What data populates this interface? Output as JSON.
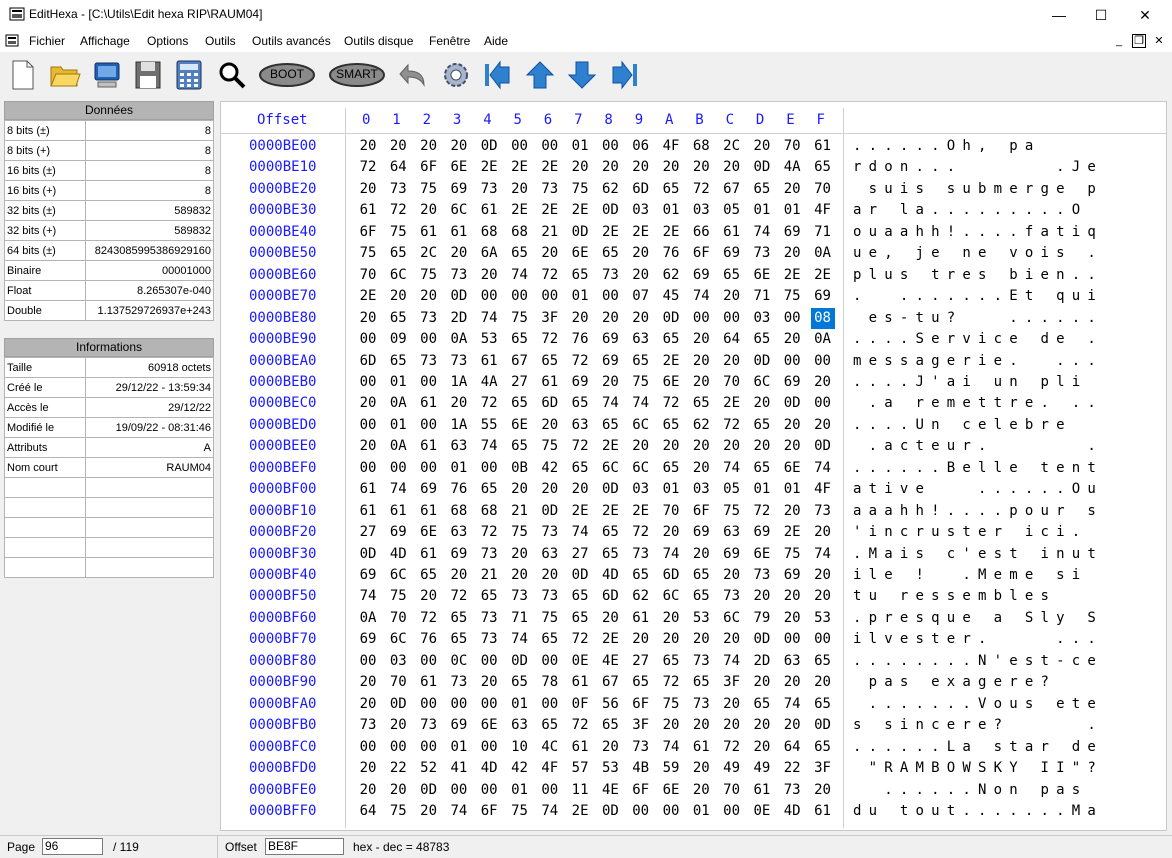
{
  "window": {
    "title": "EditHexa - [C:\\Utils\\Edit hexa RIP\\RAUM04]",
    "min": "—",
    "max": "☐",
    "close": "✕"
  },
  "menu": [
    "Fichier",
    "Affichage",
    "Options",
    "Outils",
    "Outils avancés",
    "Outils disque",
    "Fenêtre",
    "Aide"
  ],
  "mdi": {
    "min": "_",
    "restore": "❐",
    "close": "✕"
  },
  "toolbar": {
    "icons": [
      "new-file",
      "open-folder",
      "computer",
      "save",
      "calculator",
      "search",
      "boot",
      "smart",
      "undo",
      "settings",
      "first",
      "up",
      "down",
      "last"
    ],
    "boot_label": "BOOT",
    "smart_label": "SMART"
  },
  "donnees": {
    "header": "Données",
    "rows": [
      {
        "label": "8 bits (±)",
        "value": "8"
      },
      {
        "label": "8 bits (+)",
        "value": "8"
      },
      {
        "label": "16 bits (±)",
        "value": "8"
      },
      {
        "label": "16 bits (+)",
        "value": "8"
      },
      {
        "label": "32 bits (±)",
        "value": "589832"
      },
      {
        "label": "32 bits (+)",
        "value": "589832"
      },
      {
        "label": "64 bits (±)",
        "value": "8243085995386929160"
      },
      {
        "label": "Binaire",
        "value": "00001000"
      },
      {
        "label": "Float",
        "value": "8.265307e-040"
      },
      {
        "label": "Double",
        "value": "1.137529726937e+243"
      }
    ]
  },
  "informations": {
    "header": "Informations",
    "rows": [
      {
        "label": "Taille",
        "value": "60918 octets"
      },
      {
        "label": "Créé le",
        "value": "29/12/22 - 13:59:34"
      },
      {
        "label": "Accès le",
        "value": "29/12/22"
      },
      {
        "label": "Modifié le",
        "value": "19/09/22 - 08:31:46"
      },
      {
        "label": "Attributs",
        "value": "A"
      },
      {
        "label": "Nom court",
        "value": "RAUM04"
      },
      {
        "label": "",
        "value": ""
      },
      {
        "label": "",
        "value": ""
      },
      {
        "label": "",
        "value": ""
      },
      {
        "label": "",
        "value": ""
      },
      {
        "label": "",
        "value": ""
      }
    ]
  },
  "hex": {
    "offset_header": "Offset",
    "columns": [
      "0",
      "1",
      "2",
      "3",
      "4",
      "5",
      "6",
      "7",
      "8",
      "9",
      "A",
      "B",
      "C",
      "D",
      "E",
      "F"
    ],
    "selected": {
      "row": 8,
      "col": 15
    },
    "rows": [
      {
        "offset": "0000BE00",
        "bytes": [
          "20",
          "20",
          "20",
          "20",
          "0D",
          "00",
          "00",
          "01",
          "00",
          "06",
          "4F",
          "68",
          "2C",
          "20",
          "70",
          "61"
        ],
        "ascii": "......Oh, pa"
      },
      {
        "offset": "0000BE10",
        "bytes": [
          "72",
          "64",
          "6F",
          "6E",
          "2E",
          "2E",
          "2E",
          "20",
          "20",
          "20",
          "20",
          "20",
          "20",
          "0D",
          "4A",
          "65"
        ],
        "ascii": "rdon...      .Je"
      },
      {
        "offset": "0000BE20",
        "bytes": [
          "20",
          "73",
          "75",
          "69",
          "73",
          "20",
          "73",
          "75",
          "62",
          "6D",
          "65",
          "72",
          "67",
          "65",
          "20",
          "70"
        ],
        "ascii": " suis submerge p"
      },
      {
        "offset": "0000BE30",
        "bytes": [
          "61",
          "72",
          "20",
          "6C",
          "61",
          "2E",
          "2E",
          "2E",
          "0D",
          "03",
          "01",
          "03",
          "05",
          "01",
          "01",
          "4F"
        ],
        "ascii": "ar la.........O"
      },
      {
        "offset": "0000BE40",
        "bytes": [
          "6F",
          "75",
          "61",
          "61",
          "68",
          "68",
          "21",
          "0D",
          "2E",
          "2E",
          "2E",
          "66",
          "61",
          "74",
          "69",
          "71"
        ],
        "ascii": "ouaahh!....fatiq"
      },
      {
        "offset": "0000BE50",
        "bytes": [
          "75",
          "65",
          "2C",
          "20",
          "6A",
          "65",
          "20",
          "6E",
          "65",
          "20",
          "76",
          "6F",
          "69",
          "73",
          "20",
          "0A"
        ],
        "ascii": "ue, je ne vois ."
      },
      {
        "offset": "0000BE60",
        "bytes": [
          "70",
          "6C",
          "75",
          "73",
          "20",
          "74",
          "72",
          "65",
          "73",
          "20",
          "62",
          "69",
          "65",
          "6E",
          "2E",
          "2E"
        ],
        "ascii": "plus tres bien.."
      },
      {
        "offset": "0000BE70",
        "bytes": [
          "2E",
          "20",
          "20",
          "0D",
          "00",
          "00",
          "00",
          "01",
          "00",
          "07",
          "45",
          "74",
          "20",
          "71",
          "75",
          "69"
        ],
        "ascii": ".  .......Et qui"
      },
      {
        "offset": "0000BE80",
        "bytes": [
          "20",
          "65",
          "73",
          "2D",
          "74",
          "75",
          "3F",
          "20",
          "20",
          "20",
          "0D",
          "00",
          "00",
          "03",
          "00",
          "08"
        ],
        "ascii": " es-tu?   ......"
      },
      {
        "offset": "0000BE90",
        "bytes": [
          "00",
          "09",
          "00",
          "0A",
          "53",
          "65",
          "72",
          "76",
          "69",
          "63",
          "65",
          "20",
          "64",
          "65",
          "20",
          "0A"
        ],
        "ascii": "....Service de ."
      },
      {
        "offset": "0000BEA0",
        "bytes": [
          "6D",
          "65",
          "73",
          "73",
          "61",
          "67",
          "65",
          "72",
          "69",
          "65",
          "2E",
          "20",
          "20",
          "0D",
          "00",
          "00"
        ],
        "ascii": "messagerie.  ..."
      },
      {
        "offset": "0000BEB0",
        "bytes": [
          "00",
          "01",
          "00",
          "1A",
          "4A",
          "27",
          "61",
          "69",
          "20",
          "75",
          "6E",
          "20",
          "70",
          "6C",
          "69",
          "20"
        ],
        "ascii": "....J'ai un pli "
      },
      {
        "offset": "0000BEC0",
        "bytes": [
          "20",
          "0A",
          "61",
          "20",
          "72",
          "65",
          "6D",
          "65",
          "74",
          "74",
          "72",
          "65",
          "2E",
          "20",
          "0D",
          "00"
        ],
        "ascii": " .a remettre. .."
      },
      {
        "offset": "0000BED0",
        "bytes": [
          "00",
          "01",
          "00",
          "1A",
          "55",
          "6E",
          "20",
          "63",
          "65",
          "6C",
          "65",
          "62",
          "72",
          "65",
          "20",
          "20"
        ],
        "ascii": "....Un celebre  "
      },
      {
        "offset": "0000BEE0",
        "bytes": [
          "20",
          "0A",
          "61",
          "63",
          "74",
          "65",
          "75",
          "72",
          "2E",
          "20",
          "20",
          "20",
          "20",
          "20",
          "20",
          "0D"
        ],
        "ascii": " .acteur.      ."
      },
      {
        "offset": "0000BEF0",
        "bytes": [
          "00",
          "00",
          "00",
          "01",
          "00",
          "0B",
          "42",
          "65",
          "6C",
          "6C",
          "65",
          "20",
          "74",
          "65",
          "6E",
          "74"
        ],
        "ascii": "......Belle tent"
      },
      {
        "offset": "0000BF00",
        "bytes": [
          "61",
          "74",
          "69",
          "76",
          "65",
          "20",
          "20",
          "20",
          "0D",
          "03",
          "01",
          "03",
          "05",
          "01",
          "01",
          "4F",
          "75"
        ],
        "ascii": "ative   ......Ou"
      },
      {
        "offset": "0000BF10",
        "bytes": [
          "61",
          "61",
          "61",
          "68",
          "68",
          "21",
          "0D",
          "2E",
          "2E",
          "2E",
          "70",
          "6F",
          "75",
          "72",
          "20",
          "73"
        ],
        "ascii": "aaahh!....pour s"
      },
      {
        "offset": "0000BF20",
        "bytes": [
          "27",
          "69",
          "6E",
          "63",
          "72",
          "75",
          "73",
          "74",
          "65",
          "72",
          "20",
          "69",
          "63",
          "69",
          "2E",
          "20"
        ],
        "ascii": "'incruster ici. "
      },
      {
        "offset": "0000BF30",
        "bytes": [
          "0D",
          "4D",
          "61",
          "69",
          "73",
          "20",
          "63",
          "27",
          "65",
          "73",
          "74",
          "20",
          "69",
          "6E",
          "75",
          "74"
        ],
        "ascii": ".Mais c'est inut"
      },
      {
        "offset": "0000BF40",
        "bytes": [
          "69",
          "6C",
          "65",
          "20",
          "21",
          "20",
          "20",
          "0D",
          "4D",
          "65",
          "6D",
          "65",
          "20",
          "73",
          "69",
          "20"
        ],
        "ascii": "ile !  .Meme si "
      },
      {
        "offset": "0000BF50",
        "bytes": [
          "74",
          "75",
          "20",
          "72",
          "65",
          "73",
          "73",
          "65",
          "6D",
          "62",
          "6C",
          "65",
          "73",
          "20",
          "20",
          "20"
        ],
        "ascii": "tu ressembles   "
      },
      {
        "offset": "0000BF60",
        "bytes": [
          "0A",
          "70",
          "72",
          "65",
          "73",
          "71",
          "75",
          "65",
          "20",
          "61",
          "20",
          "53",
          "6C",
          "79",
          "20",
          "53"
        ],
        "ascii": ".presque a Sly S"
      },
      {
        "offset": "0000BF70",
        "bytes": [
          "69",
          "6C",
          "76",
          "65",
          "73",
          "74",
          "65",
          "72",
          "2E",
          "20",
          "20",
          "20",
          "20",
          "0D",
          "00",
          "00"
        ],
        "ascii": "ilvester.    ..."
      },
      {
        "offset": "0000BF80",
        "bytes": [
          "00",
          "03",
          "00",
          "0C",
          "00",
          "0D",
          "00",
          "0E",
          "4E",
          "27",
          "65",
          "73",
          "74",
          "2D",
          "63",
          "65"
        ],
        "ascii": "........N'est-ce"
      },
      {
        "offset": "0000BF90",
        "bytes": [
          "20",
          "70",
          "61",
          "73",
          "20",
          "65",
          "78",
          "61",
          "67",
          "65",
          "72",
          "65",
          "3F",
          "20",
          "20",
          "20"
        ],
        "ascii": " pas exagere?   "
      },
      {
        "offset": "0000BFA0",
        "bytes": [
          "20",
          "0D",
          "00",
          "00",
          "00",
          "01",
          "00",
          "0F",
          "56",
          "6F",
          "75",
          "73",
          "20",
          "65",
          "74",
          "65"
        ],
        "ascii": " .......Vous ete"
      },
      {
        "offset": "0000BFB0",
        "bytes": [
          "73",
          "20",
          "73",
          "69",
          "6E",
          "63",
          "65",
          "72",
          "65",
          "3F",
          "20",
          "20",
          "20",
          "20",
          "20",
          "0D"
        ],
        "ascii": "s sincere?     ."
      },
      {
        "offset": "0000BFC0",
        "bytes": [
          "00",
          "00",
          "00",
          "01",
          "00",
          "10",
          "4C",
          "61",
          "20",
          "73",
          "74",
          "61",
          "72",
          "20",
          "64",
          "65"
        ],
        "ascii": "......La star de"
      },
      {
        "offset": "0000BFD0",
        "bytes": [
          "20",
          "22",
          "52",
          "41",
          "4D",
          "42",
          "4F",
          "57",
          "53",
          "4B",
          "59",
          "20",
          "49",
          "49",
          "22",
          "3F"
        ],
        "ascii": " \"RAMBOWSKY II\"?"
      },
      {
        "offset": "0000BFE0",
        "bytes": [
          "20",
          "20",
          "0D",
          "00",
          "00",
          "01",
          "00",
          "11",
          "4E",
          "6F",
          "6E",
          "20",
          "70",
          "61",
          "73",
          "20"
        ],
        "ascii": "  ......Non pas "
      },
      {
        "offset": "0000BFF0",
        "bytes": [
          "64",
          "75",
          "20",
          "74",
          "6F",
          "75",
          "74",
          "2E",
          "0D",
          "00",
          "00",
          "01",
          "00",
          "0E",
          "4D",
          "61"
        ],
        "ascii": "du tout.......Ma"
      }
    ]
  },
  "status": {
    "page_label": "Page",
    "page_value": "96",
    "page_total": "/ 119",
    "offset_label": "Offset",
    "offset_value": "BE8F",
    "hexdec": "hex - dec = 48783"
  }
}
